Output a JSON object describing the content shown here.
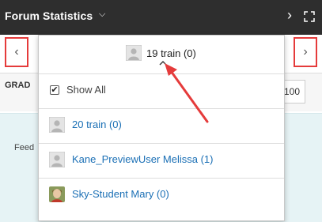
{
  "header": {
    "title": "Forum Statistics",
    "title_chevron_icon": "chevron-down-icon",
    "next_icon": "chevron-right-icon",
    "expand_icon": "expand-icon"
  },
  "nav": {
    "prev_glyph": "‹",
    "next_glyph": "›"
  },
  "background": {
    "grade_label": "GRAD",
    "grade_value": "100",
    "feedback_label": "Feed"
  },
  "dropdown": {
    "current_user": "19 train (0)",
    "show_all_label": "Show All",
    "show_all_checked": true,
    "users": [
      {
        "name": "20 train (0)",
        "avatar": "default-avatar"
      },
      {
        "name": "Kane_PreviewUser Melissa (1)",
        "avatar": "default-avatar"
      },
      {
        "name": "Sky-Student Mary (0)",
        "avatar": "photo-avatar"
      }
    ]
  },
  "colors": {
    "header_bg": "#2e2e2e",
    "highlight_border": "#e53b3b",
    "link": "#1a6fb5",
    "annotation_arrow": "#e53b3b"
  }
}
